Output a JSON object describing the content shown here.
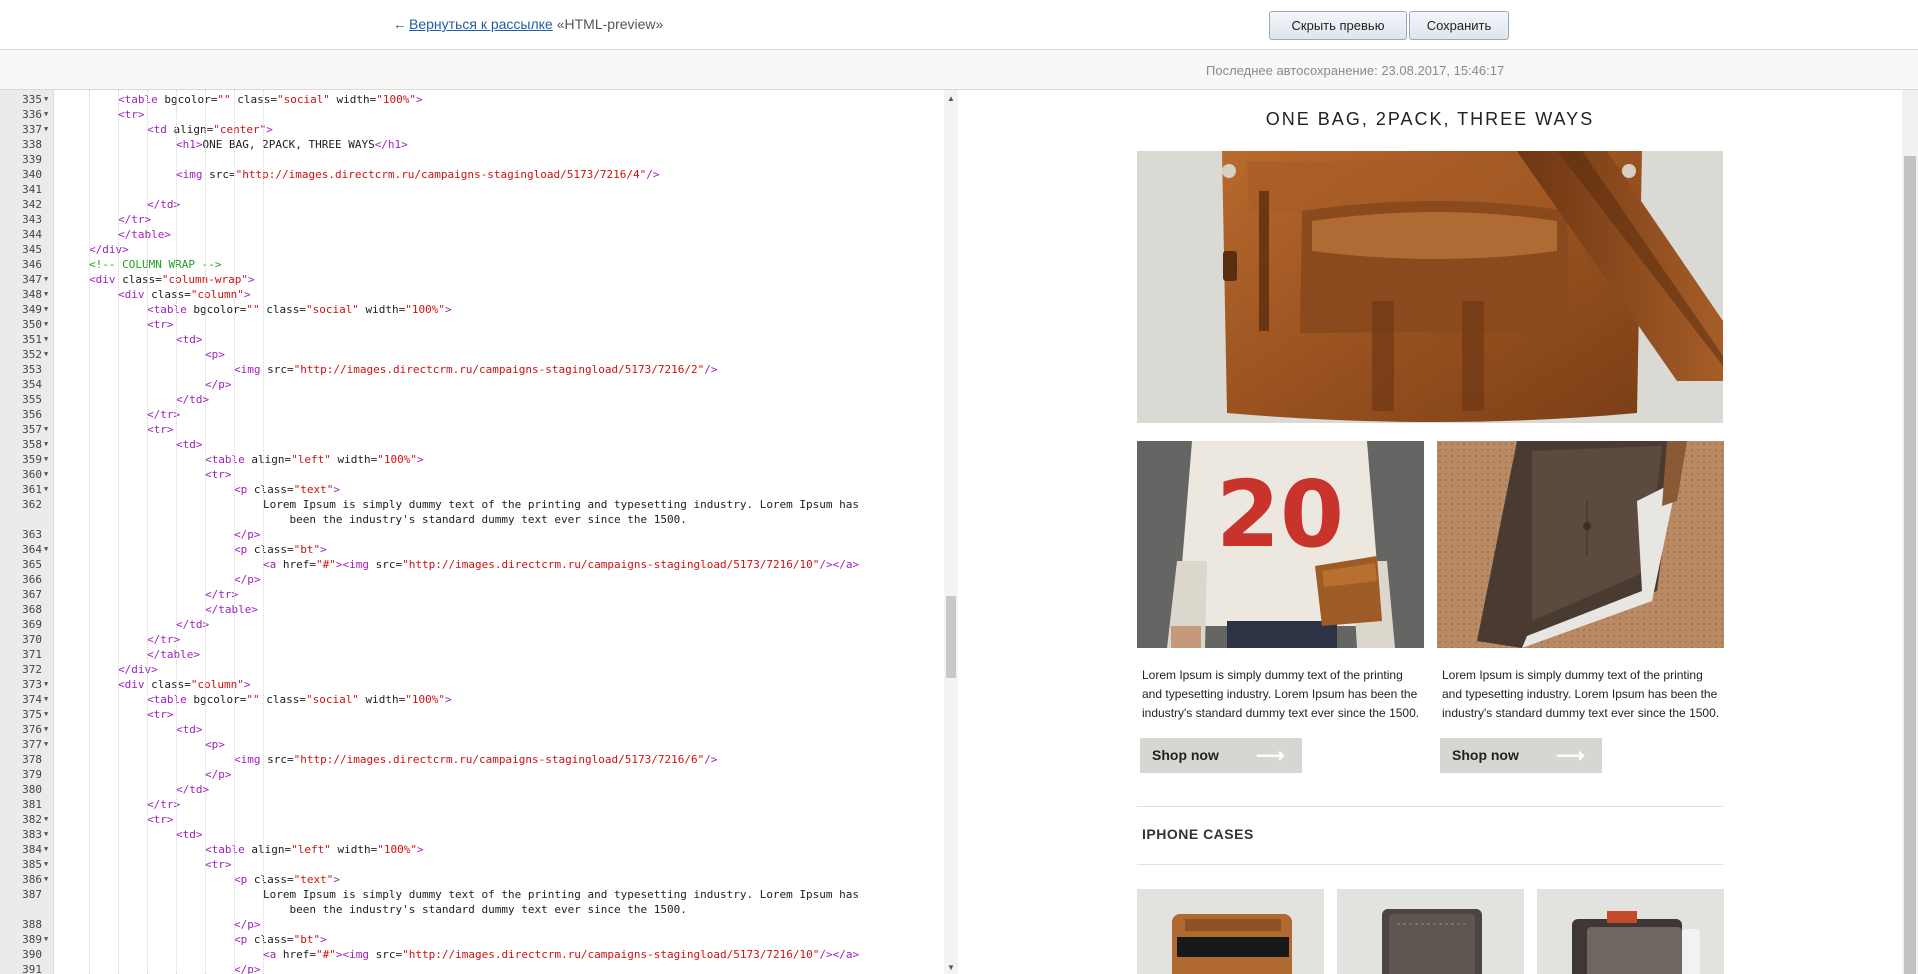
{
  "header": {
    "back_arrow": "←",
    "back_link": "Вернуться к рассылке",
    "campaign_name": "«HTML-preview»",
    "hide_preview_button": "Скрыть превью",
    "save_button": "Сохранить"
  },
  "autosave": {
    "text": "Последнее автосохранение: 23.08.2017, 15:46:17"
  },
  "editor": {
    "lines": [
      {
        "n": "335",
        "fold": true,
        "indent": 2,
        "tokens": [
          [
            "tag",
            "<table "
          ],
          [
            "attr",
            "bgcolor="
          ],
          [
            "str",
            "\"\""
          ],
          [
            "attr",
            " class="
          ],
          [
            "str",
            "\"social\""
          ],
          [
            "attr",
            " width="
          ],
          [
            "str",
            "\"100%\""
          ],
          [
            "tag",
            ">"
          ]
        ]
      },
      {
        "n": "336",
        "fold": true,
        "indent": 2,
        "tokens": [
          [
            "tag",
            "<tr>"
          ]
        ]
      },
      {
        "n": "337",
        "fold": true,
        "indent": 3,
        "tokens": [
          [
            "tag",
            "<td "
          ],
          [
            "attr",
            "align="
          ],
          [
            "str",
            "\"center\""
          ],
          [
            "tag",
            ">"
          ]
        ]
      },
      {
        "n": "338",
        "fold": false,
        "indent": 4,
        "tokens": [
          [
            "tag",
            "<h1>"
          ],
          [
            "attr",
            "ONE BAG, 2PACK, THREE WAYS"
          ],
          [
            "tag",
            "</h1>"
          ]
        ]
      },
      {
        "n": "339",
        "fold": false,
        "indent": 0,
        "tokens": []
      },
      {
        "n": "340",
        "fold": false,
        "indent": 4,
        "tokens": [
          [
            "tag",
            "<img "
          ],
          [
            "attr",
            "src="
          ],
          [
            "str",
            "\"http://images.directcrm.ru/campaigns-stagingload/5173/7216/4\""
          ],
          [
            "tag",
            "/>"
          ]
        ]
      },
      {
        "n": "341",
        "fold": false,
        "indent": 0,
        "tokens": []
      },
      {
        "n": "342",
        "fold": false,
        "indent": 3,
        "tokens": [
          [
            "tag",
            "</td>"
          ]
        ]
      },
      {
        "n": "343",
        "fold": false,
        "indent": 2,
        "tokens": [
          [
            "tag",
            "</tr>"
          ]
        ]
      },
      {
        "n": "344",
        "fold": false,
        "indent": 2,
        "tokens": [
          [
            "tag",
            "</table>"
          ]
        ]
      },
      {
        "n": "345",
        "fold": false,
        "indent": 1,
        "tokens": [
          [
            "tag",
            "</div>"
          ]
        ]
      },
      {
        "n": "346",
        "fold": false,
        "indent": 1,
        "tokens": [
          [
            "cmt",
            "<!-- COLUMN WRAP -->"
          ]
        ]
      },
      {
        "n": "347",
        "fold": true,
        "indent": 1,
        "tokens": [
          [
            "tag",
            "<div "
          ],
          [
            "attr",
            "class="
          ],
          [
            "str",
            "\"column-wrap\""
          ],
          [
            "tag",
            ">"
          ]
        ]
      },
      {
        "n": "348",
        "fold": true,
        "indent": 2,
        "tokens": [
          [
            "tag",
            "<div "
          ],
          [
            "attr",
            "class="
          ],
          [
            "str",
            "\"column\""
          ],
          [
            "tag",
            ">"
          ]
        ]
      },
      {
        "n": "349",
        "fold": true,
        "indent": 3,
        "tokens": [
          [
            "tag",
            "<table "
          ],
          [
            "attr",
            "bgcolor="
          ],
          [
            "str",
            "\"\""
          ],
          [
            "attr",
            " class="
          ],
          [
            "str",
            "\"social\""
          ],
          [
            "attr",
            " width="
          ],
          [
            "str",
            "\"100%\""
          ],
          [
            "tag",
            ">"
          ]
        ]
      },
      {
        "n": "350",
        "fold": true,
        "indent": 3,
        "tokens": [
          [
            "tag",
            "<tr>"
          ]
        ]
      },
      {
        "n": "351",
        "fold": true,
        "indent": 4,
        "tokens": [
          [
            "tag",
            "<td>"
          ]
        ]
      },
      {
        "n": "352",
        "fold": true,
        "indent": 5,
        "tokens": [
          [
            "tag",
            "<p>"
          ]
        ]
      },
      {
        "n": "353",
        "fold": false,
        "indent": 6,
        "tokens": [
          [
            "tag",
            "<img "
          ],
          [
            "attr",
            "src="
          ],
          [
            "str",
            "\"http://images.directcrm.ru/campaigns-stagingload/5173/7216/2\""
          ],
          [
            "tag",
            "/>"
          ]
        ]
      },
      {
        "n": "354",
        "fold": false,
        "indent": 5,
        "tokens": [
          [
            "tag",
            "</p>"
          ]
        ]
      },
      {
        "n": "355",
        "fold": false,
        "indent": 4,
        "tokens": [
          [
            "tag",
            "</td>"
          ]
        ]
      },
      {
        "n": "356",
        "fold": false,
        "indent": 3,
        "tokens": [
          [
            "tag",
            "</tr>"
          ]
        ]
      },
      {
        "n": "357",
        "fold": true,
        "indent": 3,
        "tokens": [
          [
            "tag",
            "<tr>"
          ]
        ]
      },
      {
        "n": "358",
        "fold": true,
        "indent": 4,
        "tokens": [
          [
            "tag",
            "<td>"
          ]
        ]
      },
      {
        "n": "359",
        "fold": true,
        "indent": 5,
        "tokens": [
          [
            "tag",
            "<table "
          ],
          [
            "attr",
            "align="
          ],
          [
            "str",
            "\"left\""
          ],
          [
            "attr",
            " width="
          ],
          [
            "str",
            "\"100%\""
          ],
          [
            "tag",
            ">"
          ]
        ]
      },
      {
        "n": "360",
        "fold": true,
        "indent": 5,
        "tokens": [
          [
            "tag",
            "<tr>"
          ]
        ]
      },
      {
        "n": "361",
        "fold": true,
        "indent": 6,
        "tokens": [
          [
            "tag",
            "<p "
          ],
          [
            "attr",
            "class="
          ],
          [
            "str",
            "\"text\""
          ],
          [
            "tag",
            ">"
          ]
        ]
      },
      {
        "n": "362",
        "fold": false,
        "indent": 7,
        "tall": true,
        "tokens": [
          [
            "attr",
            "Lorem Ipsum is simply dummy text of the printing and typesetting industry. Lorem Ipsum has\n    been the industry's standard dummy text ever since the 1500."
          ]
        ]
      },
      {
        "n": "363",
        "fold": false,
        "indent": 6,
        "tokens": [
          [
            "tag",
            "</p>"
          ]
        ]
      },
      {
        "n": "364",
        "fold": true,
        "indent": 6,
        "tokens": [
          [
            "tag",
            "<p "
          ],
          [
            "attr",
            "class="
          ],
          [
            "str",
            "\"bt\""
          ],
          [
            "tag",
            ">"
          ]
        ]
      },
      {
        "n": "365",
        "fold": false,
        "indent": 7,
        "tokens": [
          [
            "tag",
            "<a "
          ],
          [
            "attr",
            "href="
          ],
          [
            "str",
            "\"#\""
          ],
          [
            "tag",
            ">"
          ],
          [
            "tag",
            "<img "
          ],
          [
            "attr",
            "src="
          ],
          [
            "str",
            "\"http://images.directcrm.ru/campaigns-stagingload/5173/7216/10\""
          ],
          [
            "tag",
            "/></a>"
          ]
        ]
      },
      {
        "n": "366",
        "fold": false,
        "indent": 6,
        "tokens": [
          [
            "tag",
            "</p>"
          ]
        ]
      },
      {
        "n": "367",
        "fold": false,
        "indent": 5,
        "tokens": [
          [
            "tag",
            "</tr>"
          ]
        ]
      },
      {
        "n": "368",
        "fold": false,
        "indent": 5,
        "tokens": [
          [
            "tag",
            "</table>"
          ]
        ]
      },
      {
        "n": "369",
        "fold": false,
        "indent": 4,
        "tokens": [
          [
            "tag",
            "</td>"
          ]
        ]
      },
      {
        "n": "370",
        "fold": false,
        "indent": 3,
        "tokens": [
          [
            "tag",
            "</tr>"
          ]
        ]
      },
      {
        "n": "371",
        "fold": false,
        "indent": 3,
        "tokens": [
          [
            "tag",
            "</table>"
          ]
        ]
      },
      {
        "n": "372",
        "fold": false,
        "indent": 2,
        "tokens": [
          [
            "tag",
            "</div>"
          ]
        ]
      },
      {
        "n": "373",
        "fold": true,
        "indent": 2,
        "tokens": [
          [
            "tag",
            "<div "
          ],
          [
            "attr",
            "class="
          ],
          [
            "str",
            "\"column\""
          ],
          [
            "tag",
            ">"
          ]
        ]
      },
      {
        "n": "374",
        "fold": true,
        "indent": 3,
        "tokens": [
          [
            "tag",
            "<table "
          ],
          [
            "attr",
            "bgcolor="
          ],
          [
            "str",
            "\"\""
          ],
          [
            "attr",
            " class="
          ],
          [
            "str",
            "\"social\""
          ],
          [
            "attr",
            " width="
          ],
          [
            "str",
            "\"100%\""
          ],
          [
            "tag",
            ">"
          ]
        ]
      },
      {
        "n": "375",
        "fold": true,
        "indent": 3,
        "tokens": [
          [
            "tag",
            "<tr>"
          ]
        ]
      },
      {
        "n": "376",
        "fold": true,
        "indent": 4,
        "tokens": [
          [
            "tag",
            "<td>"
          ]
        ]
      },
      {
        "n": "377",
        "fold": true,
        "indent": 5,
        "tokens": [
          [
            "tag",
            "<p>"
          ]
        ]
      },
      {
        "n": "378",
        "fold": false,
        "indent": 6,
        "tokens": [
          [
            "tag",
            "<img "
          ],
          [
            "attr",
            "src="
          ],
          [
            "str",
            "\"http://images.directcrm.ru/campaigns-stagingload/5173/7216/6\""
          ],
          [
            "tag",
            "/>"
          ]
        ]
      },
      {
        "n": "379",
        "fold": false,
        "indent": 5,
        "tokens": [
          [
            "tag",
            "</p>"
          ]
        ]
      },
      {
        "n": "380",
        "fold": false,
        "indent": 4,
        "tokens": [
          [
            "tag",
            "</td>"
          ]
        ]
      },
      {
        "n": "381",
        "fold": false,
        "indent": 3,
        "tokens": [
          [
            "tag",
            "</tr>"
          ]
        ]
      },
      {
        "n": "382",
        "fold": true,
        "indent": 3,
        "tokens": [
          [
            "tag",
            "<tr>"
          ]
        ]
      },
      {
        "n": "383",
        "fold": true,
        "indent": 4,
        "tokens": [
          [
            "tag",
            "<td>"
          ]
        ]
      },
      {
        "n": "384",
        "fold": true,
        "indent": 5,
        "tokens": [
          [
            "tag",
            "<table "
          ],
          [
            "attr",
            "align="
          ],
          [
            "str",
            "\"left\""
          ],
          [
            "attr",
            " width="
          ],
          [
            "str",
            "\"100%\""
          ],
          [
            "tag",
            ">"
          ]
        ]
      },
      {
        "n": "385",
        "fold": true,
        "indent": 5,
        "tokens": [
          [
            "tag",
            "<tr>"
          ]
        ]
      },
      {
        "n": "386",
        "fold": true,
        "indent": 6,
        "tokens": [
          [
            "tag",
            "<p "
          ],
          [
            "attr",
            "class="
          ],
          [
            "str",
            "\"text\""
          ],
          [
            "tag",
            ">"
          ]
        ]
      },
      {
        "n": "387",
        "fold": false,
        "indent": 7,
        "tall": true,
        "tokens": [
          [
            "attr",
            "Lorem Ipsum is simply dummy text of the printing and typesetting industry. Lorem Ipsum has\n    been the industry's standard dummy text ever since the 1500."
          ]
        ]
      },
      {
        "n": "388",
        "fold": false,
        "indent": 6,
        "tokens": [
          [
            "tag",
            "</p>"
          ]
        ]
      },
      {
        "n": "389",
        "fold": true,
        "indent": 6,
        "tokens": [
          [
            "tag",
            "<p "
          ],
          [
            "attr",
            "class="
          ],
          [
            "str",
            "\"bt\""
          ],
          [
            "tag",
            ">"
          ]
        ]
      },
      {
        "n": "390",
        "fold": false,
        "indent": 7,
        "tokens": [
          [
            "tag",
            "<a "
          ],
          [
            "attr",
            "href="
          ],
          [
            "str",
            "\"#\""
          ],
          [
            "tag",
            ">"
          ],
          [
            "tag",
            "<img "
          ],
          [
            "attr",
            "src="
          ],
          [
            "str",
            "\"http://images.directcrm.ru/campaigns-stagingload/5173/7216/10\""
          ],
          [
            "tag",
            "/></a>"
          ]
        ]
      },
      {
        "n": "391",
        "fold": false,
        "indent": 6,
        "tokens": [
          [
            "tag",
            "</p>"
          ]
        ]
      }
    ]
  },
  "preview": {
    "title": "ONE BAG, 2PACK, THREE WAYS",
    "hero_number": "20",
    "column1_text": "Lorem Ipsum is simply dummy text of the printing and typesetting industry. Lorem Ipsum has been the industry's standard dummy text ever since the 1500.",
    "column2_text": "Lorem Ipsum is simply dummy text of the printing and typesetting industry. Lorem Ipsum has been the industry's standard dummy text ever since the 1500.",
    "shop_button_1": "Shop now",
    "shop_button_2": "Shop now",
    "shop_arrow": "⟶",
    "section_title": "IPHONE CASES"
  }
}
